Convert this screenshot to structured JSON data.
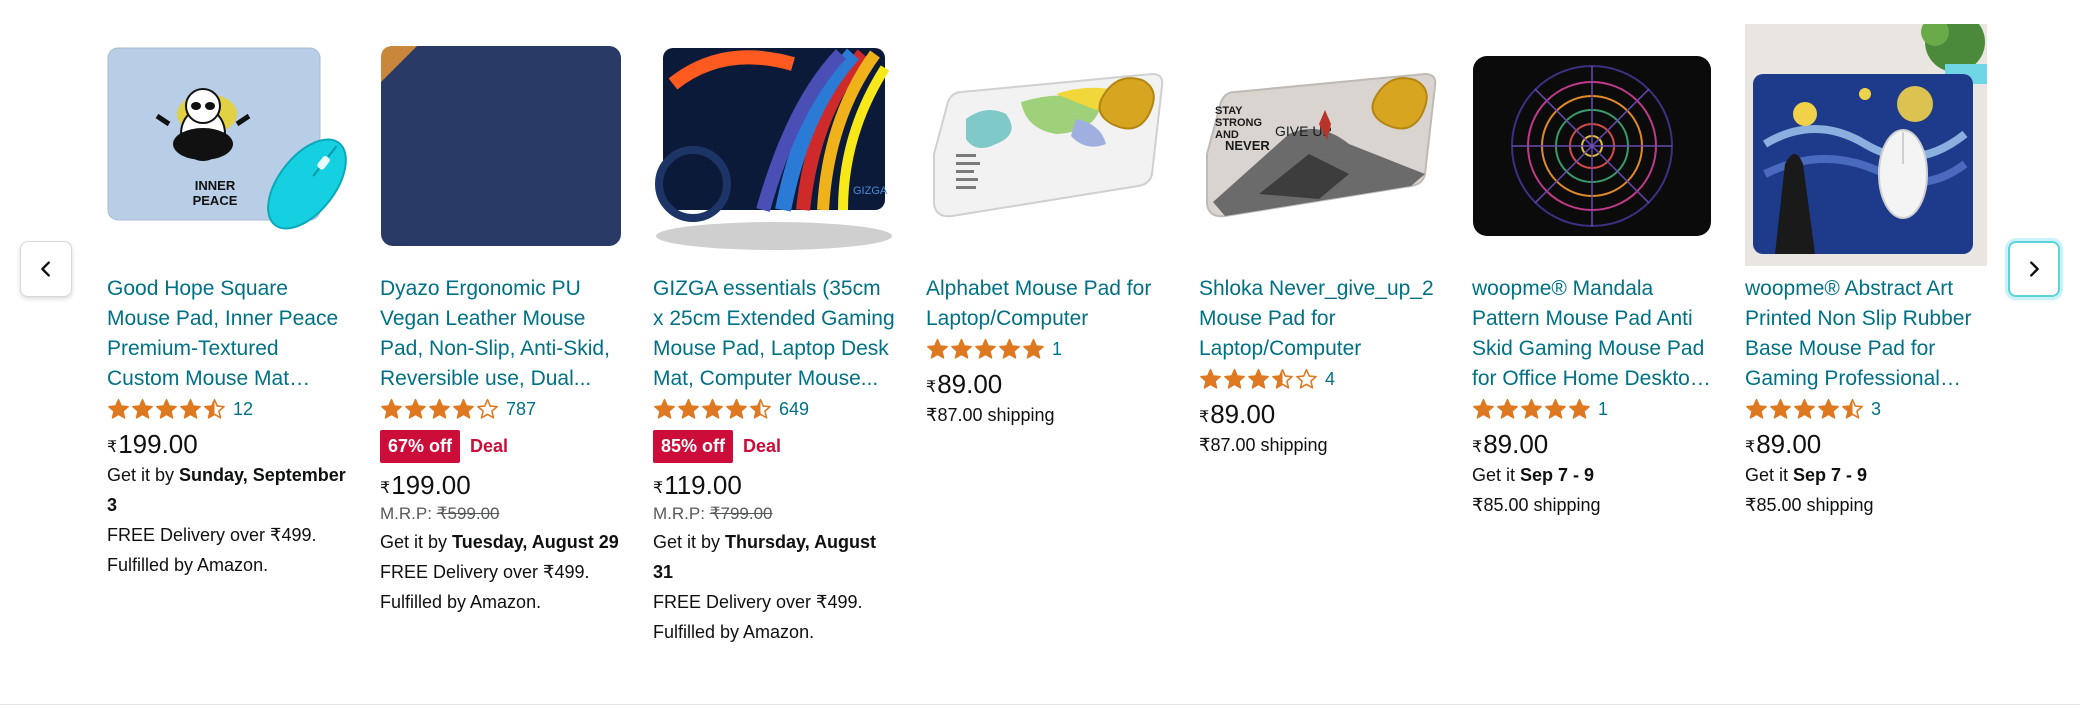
{
  "carousel": {
    "prev_icon": "chevron-left-icon",
    "next_icon": "chevron-right-icon",
    "colors": {
      "link": "#007185",
      "star": "#de7921",
      "deal": "#cc0c39"
    }
  },
  "products": [
    {
      "title": "Good Hope Square Mouse Pad, Inner Peace Premium-Textured Custom Mouse Mat Thick,Washable...",
      "rating": 4.5,
      "rating_count": "12",
      "price_symbol": "₹",
      "price": "199.00",
      "delivery_prefix": "Get it by",
      "delivery_date": "Sunday, September 3",
      "line1": "FREE Delivery over ₹499.",
      "line2": "Fulfilled by Amazon.",
      "image_text": [
        "INNER",
        "PEACE"
      ]
    },
    {
      "title": "Dyazo Ergonomic PU Vegan Leather Mouse Pad, Non-Slip, Anti-Skid, Reversible use, Dual...",
      "rating": 4.0,
      "rating_count": "787",
      "discount": "67% off",
      "deal": "Deal",
      "price_symbol": "₹",
      "price": "199.00",
      "mrp_label": "M.R.P:",
      "mrp": "₹599.00",
      "delivery_prefix": "Get it by",
      "delivery_date": "Tuesday, August 29",
      "line1": "FREE Delivery over ₹499.",
      "line2": "Fulfilled by Amazon."
    },
    {
      "title": "GIZGA essentials (35cm x 25cm Extended Gaming Mouse Pad, Laptop Desk Mat, Computer Mouse...",
      "rating": 4.5,
      "rating_count": "649",
      "discount": "85% off",
      "deal": "Deal",
      "price_symbol": "₹",
      "price": "119.00",
      "mrp_label": "M.R.P:",
      "mrp": "₹799.00",
      "delivery_prefix": "Get it by",
      "delivery_date": "Thursday, August 31",
      "line1": "FREE Delivery over ₹499.",
      "line2": "Fulfilled by Amazon.",
      "image_text": [
        "GIZGA"
      ]
    },
    {
      "title": "Alphabet Mouse Pad for Laptop/Computer",
      "rating": 5.0,
      "rating_count": "1",
      "price_symbol": "₹",
      "price": "89.00",
      "shipping": "₹87.00 shipping"
    },
    {
      "title": "Shloka Never_give_up_2 Mouse Pad for Laptop/Computer",
      "rating": 3.5,
      "rating_count": "4",
      "price_symbol": "₹",
      "price": "89.00",
      "shipping": "₹87.00 shipping",
      "image_text": [
        "STAY",
        "STRONG",
        "AND",
        "NEVER",
        "GIVE UP"
      ]
    },
    {
      "title": "woopme® Mandala Pattern Mouse Pad Anti Skid Gaming Mouse Pad for Office Home Desktop Laptop Computer...",
      "rating": 5.0,
      "rating_count": "1",
      "price_symbol": "₹",
      "price": "89.00",
      "delivery_prefix": "Get it",
      "delivery_date": "Sep 7 - 9",
      "shipping": "₹85.00 shipping"
    },
    {
      "title": "woopme® Abstract Art Printed Non Slip Rubber Base Mouse Pad for Gaming Professional Office...",
      "rating": 4.5,
      "rating_count": "3",
      "price_symbol": "₹",
      "price": "89.00",
      "delivery_prefix": "Get it",
      "delivery_date": "Sep 7 - 9",
      "shipping": "₹85.00 shipping"
    }
  ]
}
